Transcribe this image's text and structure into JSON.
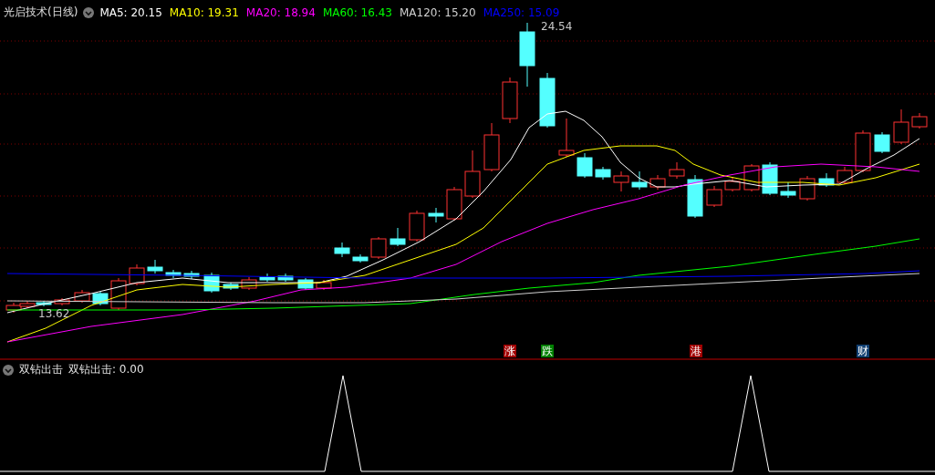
{
  "main_panel": {
    "title": "光启技术(日线)",
    "ma_legend": [
      {
        "label": "MA5: 20.15",
        "color": "#ffffff"
      },
      {
        "label": "MA10: 19.31",
        "color": "#ffff00"
      },
      {
        "label": "MA20: 18.94",
        "color": "#ff00ff"
      },
      {
        "label": "MA60: 16.43",
        "color": "#00ff00"
      },
      {
        "label": "MA120: 15.20",
        "color": "#d0d0d0"
      },
      {
        "label": "MA250: 15.09",
        "color": "#0000ff"
      }
    ],
    "high_label": "24.54",
    "low_label": "13.62",
    "event_markers": [
      {
        "text": "涨",
        "color": "#a00000"
      },
      {
        "text": "跌",
        "color": "#008000"
      },
      {
        "text": "港",
        "color": "#a00000"
      },
      {
        "text": "财",
        "color": "#103e70"
      }
    ]
  },
  "sub_panel": {
    "title": "双钻出击",
    "legend": "双钻出击: 0.00"
  }
}
